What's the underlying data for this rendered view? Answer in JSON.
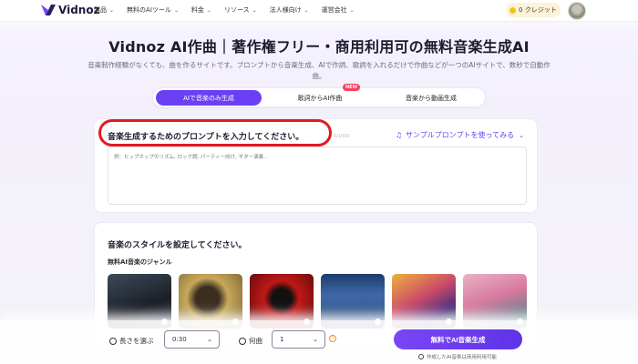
{
  "header": {
    "logo_text": "Vidnoz",
    "menu": [
      {
        "label": "製品"
      },
      {
        "label": "無料のAIツール"
      },
      {
        "label": "料金"
      },
      {
        "label": "リソース"
      },
      {
        "label": "法人様向け"
      },
      {
        "label": "運営会社"
      }
    ],
    "credit_label": "0 クレジット"
  },
  "hero": {
    "title": "Vidnoz AI作曲｜著作権フリー・商用利用可の無料音楽生成AI",
    "description": "音楽制作経験がなくても、曲を作るサイトです。プロンプトから音楽生成、AIで作詞、歌詞を入れるだけで作曲などが一つのAIサイトで、数秒で自動作曲。"
  },
  "tabs": [
    {
      "label": "AIで音楽のみ生成"
    },
    {
      "label": "歌詞からAI作曲"
    },
    {
      "label": "音楽から動画生成"
    }
  ],
  "new_badge": "NEW",
  "prompt": {
    "title": "音楽生成するためのプロンプトを入力してください。",
    "counter": "0/1000",
    "sample_label": "サンプルプロンプトを使ってみる",
    "placeholder": "例：ヒップホップのリズム, ロック調, パーティー向け, ギター演奏..."
  },
  "style": {
    "title": "音楽のスタイルを設定してください。",
    "genre_title": "無料AI音楽のジャンル"
  },
  "bottom": {
    "length_label": "長さを選ぶ",
    "length_value": "0:30",
    "count_label": "何曲",
    "count_value": "1",
    "generate_label": "無料でAI音楽生成",
    "license_note": "作成したAI音楽は商用利用可能"
  },
  "colors": {
    "accent": "#6b3ff4",
    "highlight": "#e01a22",
    "new_badge": "#ff3b5c"
  }
}
